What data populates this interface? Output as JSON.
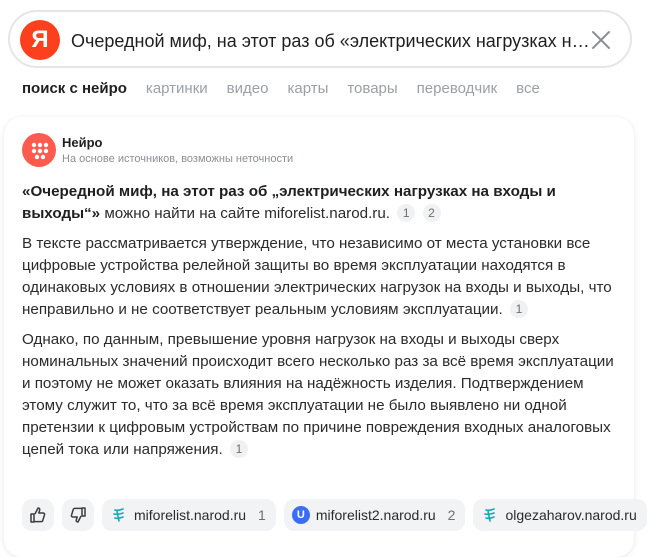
{
  "search": {
    "logo_letter": "Я",
    "query": "Очередной миф, на этот раз об «электрических нагрузках на входы и выходы»"
  },
  "tabs": [
    {
      "label": "поиск с нейро",
      "active": true
    },
    {
      "label": "картинки",
      "active": false
    },
    {
      "label": "видео",
      "active": false
    },
    {
      "label": "карты",
      "active": false
    },
    {
      "label": "товары",
      "active": false
    },
    {
      "label": "переводчик",
      "active": false
    },
    {
      "label": "все",
      "active": false
    }
  ],
  "neiro": {
    "name": "Нейро",
    "subtitle": "На основе источников, возможны неточности"
  },
  "answer": {
    "title_bold": "«Очередной миф, на этот раз об „электрических нагрузках на входы и выходы“»",
    "title_rest": " можно найти на сайте miforelist.narod.ru.",
    "title_refs": [
      "1",
      "2"
    ],
    "para1": "В тексте рассматривается утверждение, что независимо от места установки все цифровые устройства релейной защиты во время эксплуатации находятся в одинаковых условиях в отношении электрических нагрузок на входы и выходы, что неправильно и не соответствует реальным условиям эксплуатации.",
    "para1_ref": "1",
    "para2": "Однако, по данным, превышение уровня нагрузок на входы и выходы сверх номинальных значений происходит всего несколько раз за всё время эксплуатации и поэтому не может оказать влияния на надёжность изделия. Подтверждением этому служит то, что за всё время эксплуатации не было выявлено ни одной претензии к цифровым устройствам по причине повреждения входных аналоговых цепей тока или напряжения.",
    "para2_ref": "1"
  },
  "sources": [
    {
      "domain": "miforelist.narod.ru",
      "num": "1",
      "icon": "narod-icon"
    },
    {
      "domain": "miforelist2.narod.ru",
      "num": "2",
      "icon": "u-icon",
      "letter": "U"
    },
    {
      "domain": "olgezaharov.narod.ru",
      "num": "",
      "icon": "narod-icon"
    }
  ],
  "colors": {
    "yandex_red": "#fc3f1d",
    "neiro_red": "#ff5a4e",
    "narod_teal": "#1aa6b7",
    "u_blue": "#3b6ef5"
  }
}
